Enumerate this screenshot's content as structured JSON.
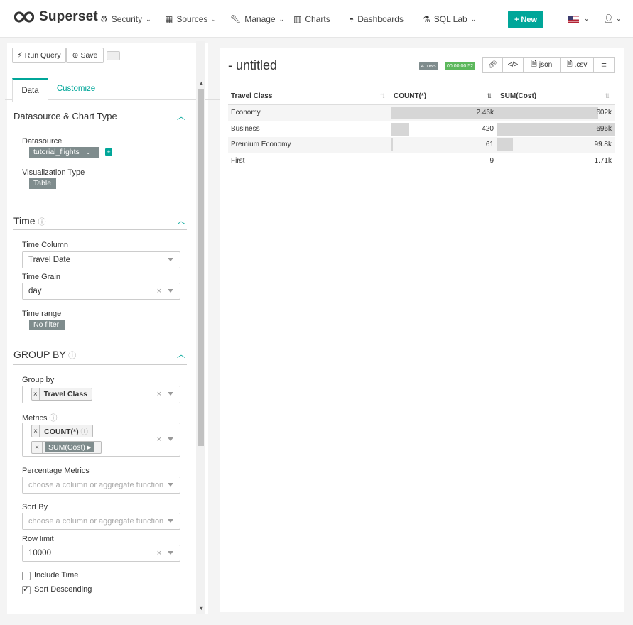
{
  "navbar": {
    "brand": "Superset",
    "items": [
      {
        "label": "Security",
        "icon": "cogs-icon",
        "dropdown": true
      },
      {
        "label": "Sources",
        "icon": "table-icon",
        "dropdown": true
      },
      {
        "label": "Manage",
        "icon": "wrench-icon",
        "dropdown": true
      },
      {
        "label": "Charts",
        "icon": "bar-chart-icon",
        "dropdown": false
      },
      {
        "label": "Dashboards",
        "icon": "dashboard-icon",
        "dropdown": false
      },
      {
        "label": "SQL Lab",
        "icon": "flask-icon",
        "dropdown": true
      }
    ],
    "new_button": "+ New",
    "accent": "#00a699"
  },
  "toolbar": {
    "run_query": "Run Query",
    "save": "Save"
  },
  "tabs": [
    "Data",
    "Customize"
  ],
  "sections": {
    "datasource": {
      "title": "Datasource & Chart Type",
      "datasource_label": "Datasource",
      "datasource_value": "tutorial_flights",
      "viz_label": "Visualization Type",
      "viz_value": "Table"
    },
    "time": {
      "title": "Time",
      "time_column_label": "Time Column",
      "time_column_value": "Travel Date",
      "time_grain_label": "Time Grain",
      "time_grain_value": "day",
      "time_range_label": "Time range",
      "time_range_value": "No filter"
    },
    "group_by": {
      "title": "GROUP BY",
      "group_by_label": "Group by",
      "group_by_chips": [
        "Travel Class"
      ],
      "metrics_label": "Metrics",
      "metrics_chips": [
        "COUNT(*)",
        "SUM(Cost)"
      ],
      "pct_metrics_label": "Percentage Metrics",
      "pct_metrics_placeholder": "choose a column or aggregate function",
      "sort_by_label": "Sort By",
      "sort_by_placeholder": "choose a column or aggregate function",
      "row_limit_label": "Row limit",
      "row_limit_value": "10000",
      "include_time_label": "Include Time",
      "include_time_checked": false,
      "sort_desc_label": "Sort Descending",
      "sort_desc_checked": true
    }
  },
  "chart": {
    "title": "- untitled",
    "rows_badge": "4 rows",
    "time_badge": "00:00:00.52",
    "buttons": [
      "json",
      ".csv"
    ],
    "columns": [
      "Travel Class",
      "COUNT(*)",
      "SUM(Cost)"
    ],
    "rows": [
      {
        "travel_class": "Economy",
        "count": "2.46k",
        "count_pct": 100,
        "sum": "602k",
        "sum_pct": 86
      },
      {
        "travel_class": "Business",
        "count": "420",
        "count_pct": 17,
        "sum": "696k",
        "sum_pct": 100
      },
      {
        "travel_class": "Premium Economy",
        "count": "61",
        "count_pct": 2,
        "sum": "99.8k",
        "sum_pct": 14
      },
      {
        "travel_class": "First",
        "count": "9",
        "count_pct": 0.4,
        "sum": "1.71k",
        "sum_pct": 0.2
      }
    ]
  }
}
